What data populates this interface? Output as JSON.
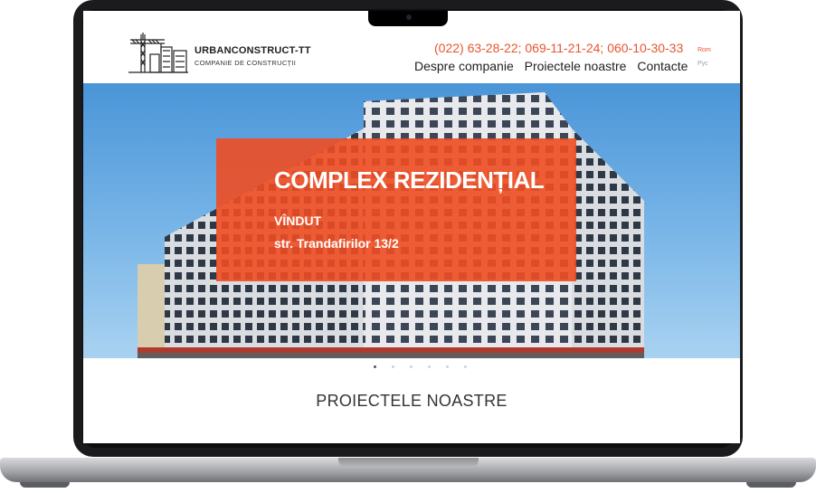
{
  "header": {
    "brand_name": "URBANCONSTRUCT-TT",
    "brand_sub": "COMPANIE DE CONSTRUCȚII",
    "phones": "(022) 63-28-22; 069-11-21-24; 060-10-30-33",
    "nav": [
      "Despre companie",
      "Proiectele noastre",
      "Contacte"
    ],
    "lang_ro": "Rom",
    "lang_ru": "Рус"
  },
  "hero": {
    "title": "COMPLEX REZIDENȚIAL",
    "status": "VÎNDUT",
    "address": "str. Trandafirilor 13/2",
    "slide_count": 6,
    "active_slide": 1
  },
  "section": {
    "title": "PROIECTELE NOASTRE"
  },
  "colors": {
    "accent": "#e8542e",
    "overlay": "#ee4c22"
  }
}
